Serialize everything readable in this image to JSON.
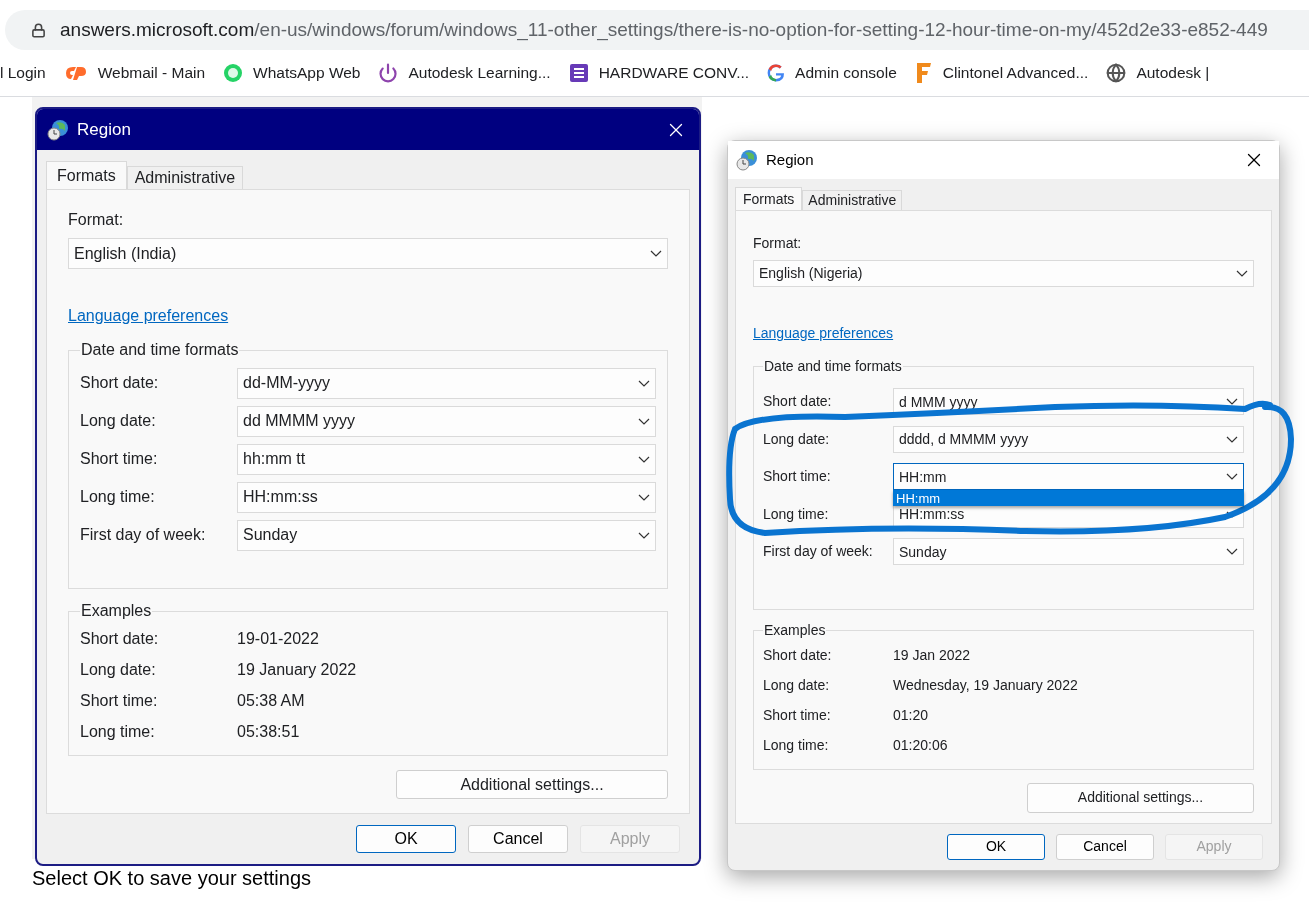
{
  "browser": {
    "url_host": "answers.microsoft.com",
    "url_path": "/en-us/windows/forum/windows_11-other_settings/there-is-no-option-for-setting-12-hour-time-on-my/452d2e33-e852-449",
    "bookmarks": [
      {
        "label": "l Login",
        "kind": "none"
      },
      {
        "label": "Webmail - Main",
        "kind": "cpanel"
      },
      {
        "label": "WhatsApp Web",
        "kind": "chat"
      },
      {
        "label": "Autodesk Learning...",
        "kind": "power"
      },
      {
        "label": "HARDWARE CONV...",
        "kind": "sheet"
      },
      {
        "label": "Admin console",
        "kind": "google"
      },
      {
        "label": "Clintonel Advanced...",
        "kind": "letter"
      },
      {
        "label": "Autodesk |",
        "kind": "globe"
      }
    ]
  },
  "dialogs": [
    {
      "kind": "classic",
      "title": "Region",
      "tabs": [
        {
          "label": "Formats",
          "selected": true
        },
        {
          "label": "Administrative",
          "selected": false
        }
      ],
      "format_label": "Format:",
      "format_value": "English (India)",
      "link": "Language preferences",
      "formats_title": "Date and time formats",
      "fields": [
        {
          "label": "Short date:",
          "value": "dd-MM-yyyy",
          "focused": false
        },
        {
          "label": "Long date:",
          "value": "dd MMMM yyyy",
          "focused": false
        },
        {
          "label": "Short time:",
          "value": "hh:mm tt",
          "focused": false
        },
        {
          "label": "Long time:",
          "value": "HH:mm:ss",
          "focused": false
        },
        {
          "label": "First day of week:",
          "value": "Sunday",
          "focused": false
        }
      ],
      "examples_title": "Examples",
      "examples": [
        {
          "label": "Short date:",
          "value": "19-01-2022"
        },
        {
          "label": "Long date:",
          "value": "19 January 2022"
        },
        {
          "label": "Short time:",
          "value": "05:38 AM"
        },
        {
          "label": "Long time:",
          "value": "05:38:51"
        }
      ],
      "additional": "Additional settings...",
      "buttons": [
        {
          "label": "OK",
          "default": true,
          "disabled": false
        },
        {
          "label": "Cancel",
          "default": false,
          "disabled": false
        },
        {
          "label": "Apply",
          "default": false,
          "disabled": true
        }
      ]
    },
    {
      "kind": "modern",
      "title": "Region",
      "tabs": [
        {
          "label": "Formats",
          "selected": true
        },
        {
          "label": "Administrative",
          "selected": false
        }
      ],
      "format_label": "Format:",
      "format_value": "English (Nigeria)",
      "link": "Language preferences",
      "formats_title": "Date and time formats",
      "fields": [
        {
          "label": "Short date:",
          "value": "d MMM yyyy",
          "focused": false
        },
        {
          "label": "Long date:",
          "value": "dddd, d MMMM yyyy",
          "focused": false
        },
        {
          "label": "Short time:",
          "value": "HH:mm",
          "focused": true,
          "options": [
            {
              "label": "HH:mm",
              "selected": true
            }
          ]
        },
        {
          "label": "Long time:",
          "value": "HH:mm:ss",
          "focused": false
        },
        {
          "label": "First day of week:",
          "value": "Sunday",
          "focused": false
        }
      ],
      "examples_title": "Examples",
      "examples": [
        {
          "label": "Short date:",
          "value": "19 Jan 2022"
        },
        {
          "label": "Long date:",
          "value": "Wednesday, 19 January 2022"
        },
        {
          "label": "Short time:",
          "value": "01:20"
        },
        {
          "label": "Long time:",
          "value": "01:20:06"
        }
      ],
      "additional": "Additional settings...",
      "buttons": [
        {
          "label": "OK",
          "default": true,
          "disabled": false
        },
        {
          "label": "Cancel",
          "default": false,
          "disabled": false
        },
        {
          "label": "Apply",
          "default": false,
          "disabled": true
        }
      ]
    }
  ],
  "caption": "Select OK to save your settings"
}
